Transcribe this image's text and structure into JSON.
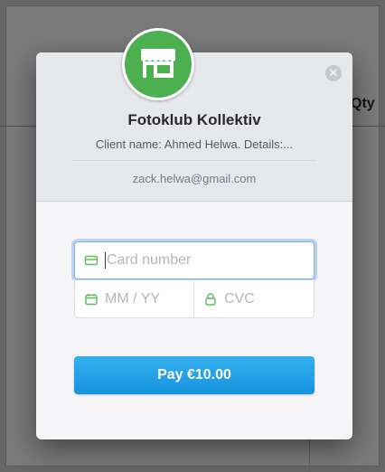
{
  "background": {
    "column_header": "Qty"
  },
  "checkout": {
    "store_name": "Fotoklub Kollektiv",
    "client_line": "Client name: Ahmed Helwa. Details:...",
    "email": "zack.helwa@gmail.com",
    "close_icon": "close-icon",
    "logo_icon": "storefront-icon",
    "brand_color": "#4caf50",
    "accent_color": "#1f9ee8"
  },
  "form": {
    "card_number": {
      "value": "",
      "placeholder": "Card number",
      "icon": "credit-card-icon"
    },
    "expiry": {
      "value": "",
      "placeholder": "MM / YY",
      "icon": "calendar-icon"
    },
    "cvc": {
      "value": "",
      "placeholder": "CVC",
      "icon": "lock-icon"
    }
  },
  "pay_button": {
    "label": "Pay €10.00"
  }
}
